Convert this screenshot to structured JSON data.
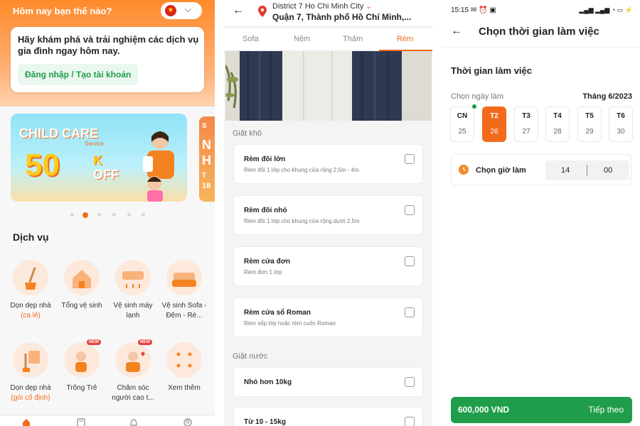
{
  "home": {
    "greeting": "Hôm nay bạn thế nào?",
    "flag_star": "★",
    "lang_chevron": "⌵",
    "welcome_text": "Hãy khám phá và trải nghiệm các dịch vụ gia đình ngay hôm nay.",
    "login_label": "Đăng nhập / Tạo tài khoản",
    "banner": {
      "title": "CHILD CARE",
      "subtitle": "Service",
      "amount": "50",
      "unit": "K",
      "off": "OFF",
      "side_letters": [
        "S",
        "N",
        "H",
        "T",
        "18"
      ]
    },
    "carousel_active_index": 1,
    "services_title": "Dịch vụ",
    "services": [
      {
        "label": "Dọn dẹp nhà",
        "sub": "(ca lẻ)",
        "icon": "broom-icon",
        "badge": ""
      },
      {
        "label": "Tổng vệ sinh",
        "sub": "",
        "icon": "house-clean-icon",
        "badge": ""
      },
      {
        "label": "Vệ sinh máy lạnh",
        "sub": "",
        "icon": "air-conditioner-icon",
        "badge": ""
      },
      {
        "label": "Vệ sinh Sofa - Đệm - Rè...",
        "sub": "",
        "icon": "sofa-icon",
        "badge": ""
      },
      {
        "label": "Dọn dẹp nhà",
        "sub": "(gói cố định)",
        "icon": "calendar-cleaning-icon",
        "badge": ""
      },
      {
        "label": "Trông Trẻ",
        "sub": "",
        "icon": "child-care-icon",
        "badge": "NEW"
      },
      {
        "label": "Chăm sóc người cao t...",
        "sub": "",
        "icon": "elderly-care-icon",
        "badge": "NEW"
      },
      {
        "label": "Xem thêm",
        "sub": "",
        "icon": "more-dots-icon",
        "badge": ""
      }
    ],
    "nav": [
      "home-icon",
      "activity-icon",
      "notification-icon",
      "account-icon"
    ]
  },
  "curtain": {
    "back": "←",
    "location_line1": "District 7 Ho Chi Minh City",
    "location_chevron": "⌄",
    "location_line2": "Quận 7, Thành phố Hồ Chí Minh,...",
    "tabs": [
      "Sofa",
      "Nệm",
      "Thảm",
      "Rèm"
    ],
    "active_tab": "Rèm",
    "dry_section": "Giặt khô",
    "dry_options": [
      {
        "title": "Rèm đôi lớn",
        "desc": "Rèm đôi 1 lớp cho khung cửa rộng 2,5m - 4m"
      },
      {
        "title": "Rèm đôi nhỏ",
        "desc": "Rèm đôi 1 lớp cho khung cửa rộng dưới 2,5m"
      },
      {
        "title": "Rèm cửa đơn",
        "desc": "Rèm đơn 1 lớp"
      },
      {
        "title": "Rèm cửa sổ Roman",
        "desc": "Rèm xếp lớp hoặc rèm cuốn Roman"
      }
    ],
    "wet_section": "Giặt nước",
    "wet_options": [
      {
        "title": "Nhỏ hơn 10kg",
        "desc": ""
      },
      {
        "title": "Từ 10 - 15kg",
        "desc": ""
      }
    ]
  },
  "schedule": {
    "status_time": "15:15",
    "status_icons": "✉ ⏰ ▣",
    "status_right": "▂▄▆ ▂▄▆ ◔ ▭ ⚡",
    "back": "←",
    "title": "Chọn thời gian làm việc",
    "section_title": "Thời gian làm việc",
    "pick_day_label": "Chọn ngày làm",
    "month": "Tháng 6/2023",
    "days": [
      {
        "name": "CN",
        "num": "25"
      },
      {
        "name": "T2",
        "num": "26"
      },
      {
        "name": "T3",
        "num": "27"
      },
      {
        "name": "T4",
        "num": "28"
      },
      {
        "name": "T5",
        "num": "29"
      },
      {
        "name": "T6",
        "num": "30"
      }
    ],
    "selected_day": "T2",
    "time_label": "Chọn giờ làm",
    "hour": "14",
    "minute": "00",
    "price": "600,000 VND",
    "next_label": "Tiếp theo"
  },
  "colors": {
    "brand_orange": "#f26a1b",
    "brand_green": "#1f9d4a",
    "badge_red": "#e8413c"
  }
}
